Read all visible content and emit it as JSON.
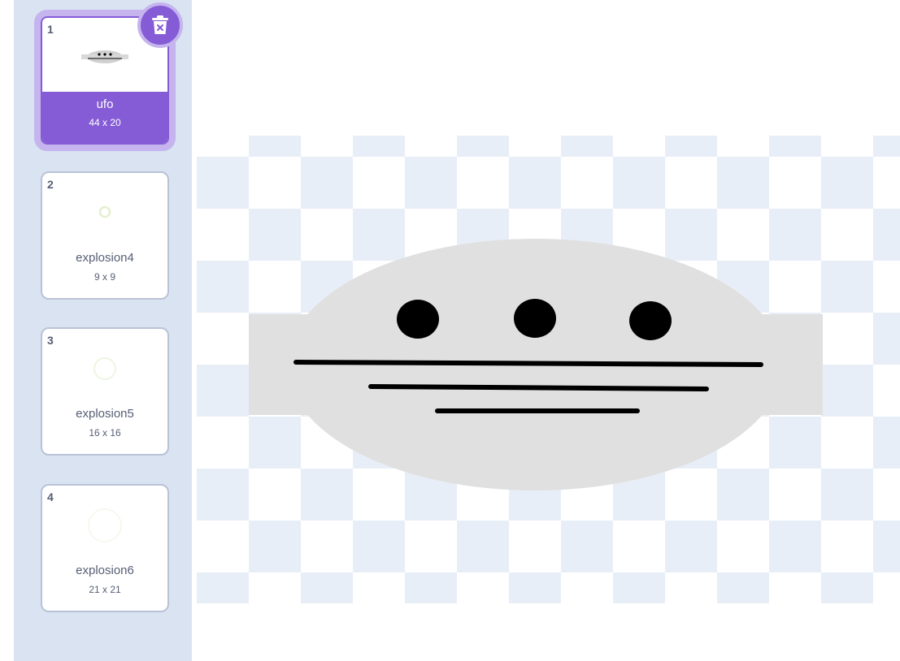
{
  "costumes": [
    {
      "number": "1",
      "name": "ufo",
      "size": "44 x 20",
      "selected": true
    },
    {
      "number": "2",
      "name": "explosion4",
      "size": "9 x 9",
      "selected": false
    },
    {
      "number": "3",
      "name": "explosion5",
      "size": "16 x 16",
      "selected": false
    },
    {
      "number": "4",
      "name": "explosion6",
      "size": "21 x 21",
      "selected": false
    }
  ],
  "icons": {
    "delete": "trash-icon"
  },
  "colors": {
    "accent": "#855cd6",
    "accent_light": "#c5b4ee",
    "sidebar_bg": "#d9e3f2",
    "checker": "#e8eef7",
    "ufo_body": "#e0e0e0",
    "ufo_detail": "#000000"
  }
}
